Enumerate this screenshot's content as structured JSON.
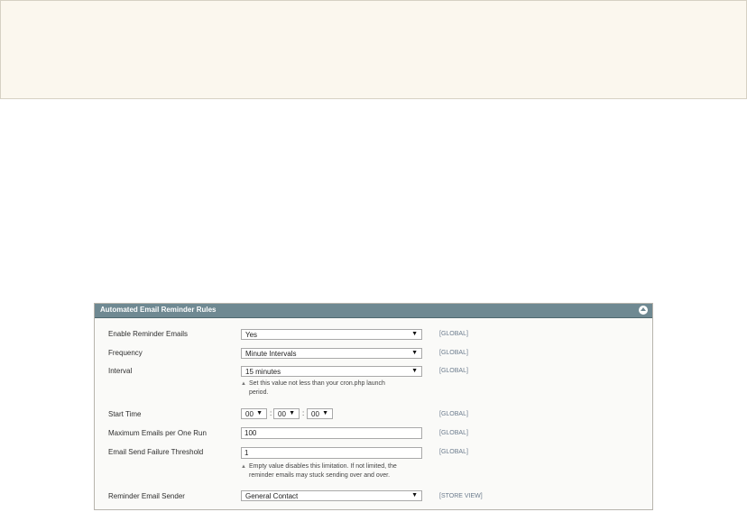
{
  "panel": {
    "title": "Automated Email Reminder Rules"
  },
  "rows": {
    "enable": {
      "label": "Enable Reminder Emails",
      "value": "Yes",
      "scope": "[GLOBAL]"
    },
    "frequency": {
      "label": "Frequency",
      "value": "Minute Intervals",
      "scope": "[GLOBAL]"
    },
    "interval": {
      "label": "Interval",
      "value": "15 minutes",
      "scope": "[GLOBAL]",
      "note_line1": "Set this value not less than your cron.php launch",
      "note_line2": "period."
    },
    "start_time": {
      "label": "Start Time",
      "hour": "00",
      "minute": "00",
      "second": "00",
      "scope": "[GLOBAL]"
    },
    "max_emails": {
      "label": "Maximum Emails per One Run",
      "value": "100",
      "scope": "[GLOBAL]"
    },
    "failure_threshold": {
      "label": "Email Send Failure Threshold",
      "value": "1",
      "scope": "[GLOBAL]",
      "note_line1": "Empty value disables this limitation. If not limited, the",
      "note_line2": "reminder emails may stuck sending over and over."
    },
    "sender": {
      "label": "Reminder Email Sender",
      "value": "General Contact",
      "scope": "[STORE VIEW]"
    }
  },
  "icons": {
    "collapse": "collapse-up-icon",
    "dropdown": "chevron-down-icon",
    "note": "note-triangle-icon"
  },
  "colors": {
    "header": "#6f8992",
    "notice_bg": "#fbf7ee",
    "scope_text": "#6b7b8d"
  }
}
